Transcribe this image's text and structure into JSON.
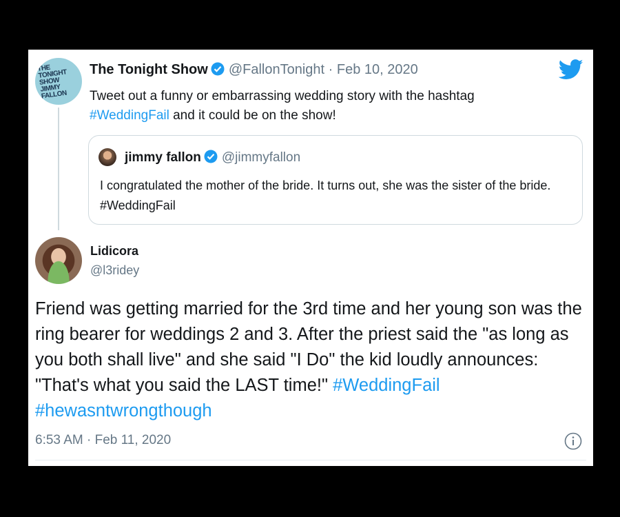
{
  "colors": {
    "background": "#000000",
    "card": "#ffffff",
    "link": "#1d9bf0",
    "verified": "#1d9bf0",
    "muted": "#657786",
    "twitter_blue": "#1d9bf0"
  },
  "parent_tweet": {
    "avatar_text": "THE TONIGHT SHOW JIMMY FALLON",
    "author_name": "The Tonight Show",
    "handle": "@FallonTonight",
    "date": "· Feb 10, 2020",
    "text_plain": "Tweet out a funny or embarrassing wedding story with the hashtag",
    "hashtag": "#WeddingFail",
    "text_tail": " and it could be on the show!",
    "quoted": {
      "author_name": "jimmy fallon",
      "handle": "@jimmyfallon",
      "text": "I congratulated the mother of the bride. It turns out, she was the sister of the bride. #WeddingFail"
    }
  },
  "reply_tweet": {
    "author_name": "Lidicora",
    "handle": "@l3ridey",
    "text": "Friend was getting married for the 3rd time and her young son was the ring bearer for weddings 2 and 3. After the priest said the \"as long as you both shall live\" and she said \"I Do\" the kid loudly announces: \"That's what you said the LAST time!\" ",
    "hashtags": "#WeddingFail #hewasntwrongthough",
    "timestamp": "6:53 AM · Feb 11, 2020"
  },
  "icons": {
    "logo": "twitter-bird-icon",
    "verified": "verified-badge-icon",
    "info": "info-icon"
  }
}
